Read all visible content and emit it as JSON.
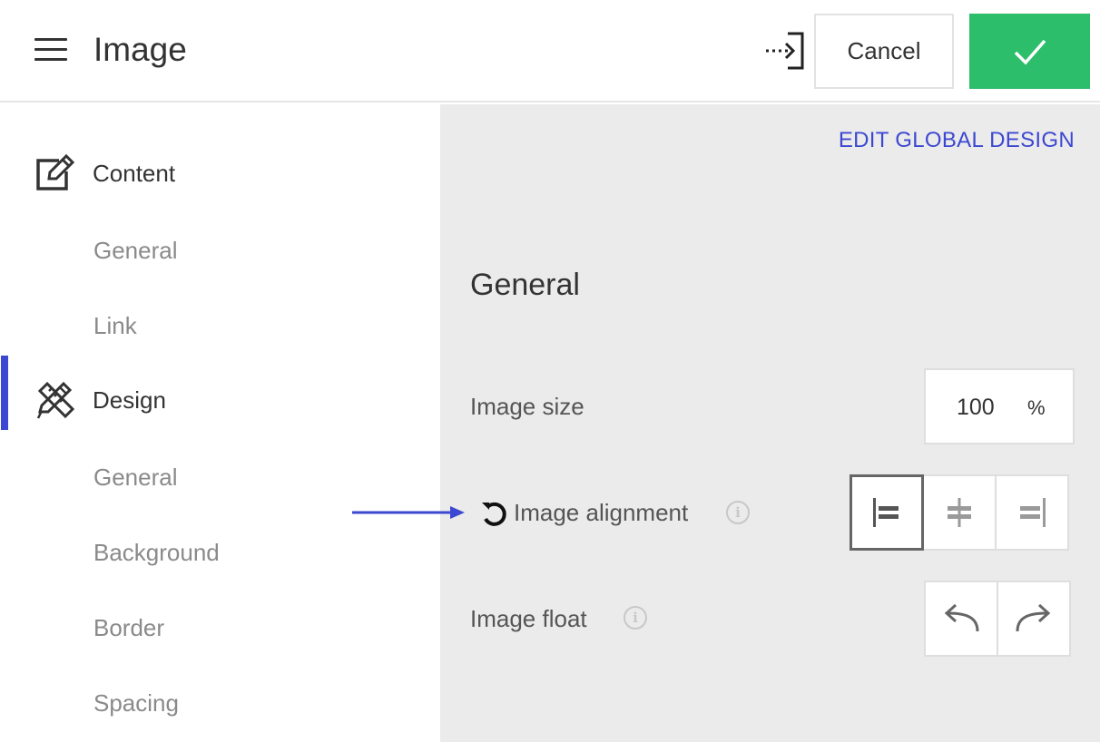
{
  "header": {
    "title": "Image",
    "cancel_label": "Cancel",
    "menu_icon": "hamburger-menu-icon",
    "exit_icon": "exit-arrow-icon",
    "confirm_icon": "checkmark-icon",
    "confirm_color": "#2dbe6c"
  },
  "sidebar": {
    "accent_color": "#3c48d1",
    "sections": [
      {
        "label": "Content",
        "icon": "edit-icon",
        "items": [
          "General",
          "Link"
        ]
      },
      {
        "label": "Design",
        "icon": "pencil-ruler-icon",
        "active": true,
        "items": [
          "General",
          "Background",
          "Border",
          "Spacing"
        ]
      }
    ]
  },
  "main": {
    "edit_global_label": "EDIT GLOBAL DESIGN",
    "section_title": "General",
    "image_size": {
      "label": "Image size",
      "value": "100",
      "unit": "%"
    },
    "image_alignment": {
      "label": "Image alignment",
      "options": [
        "align-left-icon",
        "align-center-icon",
        "align-right-icon"
      ],
      "selected": "align-left-icon"
    },
    "image_float": {
      "label": "Image float",
      "options": [
        "float-left-arrow-icon",
        "float-right-arrow-icon"
      ]
    }
  }
}
